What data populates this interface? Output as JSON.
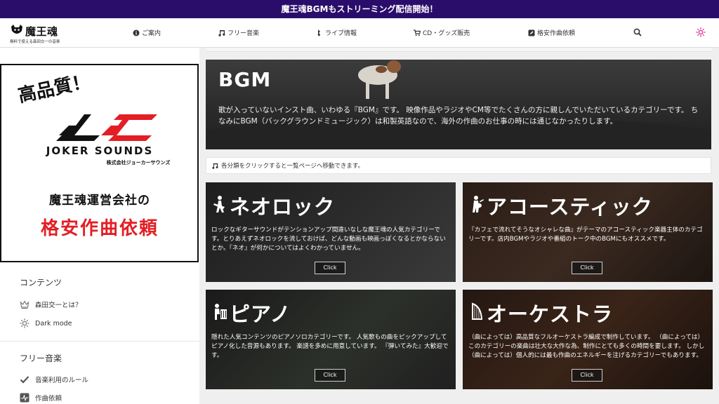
{
  "announcement": "魔王魂BGMもストリーミング配信開始！",
  "header": {
    "logo_title": "魔王魂",
    "logo_subtitle": "無料で使える森田交一の音楽",
    "nav": [
      {
        "label": "ご案内",
        "icon": "info-icon"
      },
      {
        "label": "フリー音楽",
        "icon": "music-note-icon"
      },
      {
        "label": "ライブ情報",
        "icon": "guitar-icon"
      },
      {
        "label": "CD・グッズ販売",
        "icon": "cart-icon"
      },
      {
        "label": "格安作曲依頼",
        "icon": "pen-square-icon"
      }
    ]
  },
  "banner": {
    "quality": "高品質！",
    "brand": "JOKER SOUNDS",
    "company": "株式会社ジョーカーサウンズ",
    "line1": "魔王魂運営会社の",
    "line2": "格安作曲依頼"
  },
  "sidebar": {
    "contents_heading": "コンテンツ",
    "contents_items": [
      {
        "label": "森田交一とは？",
        "icon": "crown-icon"
      },
      {
        "label": "Dark mode",
        "icon": "sun-icon"
      }
    ],
    "music_heading": "フリー音楽",
    "music_items": [
      {
        "label": "音楽利用のルール",
        "icon": "check-icon"
      },
      {
        "label": "作曲依頼",
        "icon": "pulse-icon"
      }
    ]
  },
  "hero": {
    "title": "BGM",
    "description": "歌が入っていないインスト曲、いわゆる『BGM』です。 映像作品やラジオやCM等でたくさんの方に親しんでいただいているカテゴリーです。 ちなみにBGM（バックグラウンドミュージック）は和製英語なので、海外の作曲のお仕事の時には通じなかったりします。"
  },
  "notice": "各分類をクリックすると一覧ページへ移動できます。",
  "cards": [
    {
      "title": "ネオロック",
      "icon": "rock-guitarist-icon",
      "description": "ロックなギターサウンドがテンションアップ間違いなしな魔王魂の人気カテゴリーです。とりあえずネオロックを流しておけば、どんな動画も映画っぽくなるとかならないとか。『ネオ』が何かについてはよくわかっていません。",
      "button": "Click"
    },
    {
      "title": "アコースティック",
      "icon": "acoustic-guitarist-icon",
      "description": "『カフェで流れてそうなオシャレな曲』がテーマのアコースティック楽器主体のカテゴリーです。店内BGMやラジオや番組のトーク中のBGMにもオススメです。",
      "button": "Click"
    },
    {
      "title": "ピアノ",
      "icon": "pianist-icon",
      "description": "隠れた人気コンテンツのピアノソロカテゴリーです。 人気歌もの曲をピックアップしてピアノ化した音源もあります。 楽譜を多めに用意しています。 『弾いてみた』大歓迎です。",
      "button": "Click"
    },
    {
      "title": "オーケストラ",
      "icon": "harp-icon",
      "description": "（曲によっては）高品質なフルオーケストラ編成で制作しています。 （曲によっては）このカテゴリーの楽曲は壮大な大作な為、制作にとても多くの時間を要します。 しかし（曲によっては）個人的には最も作曲のエネルギーを注げるカテゴリーでもあります。",
      "button": "Click"
    }
  ],
  "colors": {
    "announce_bg": "#2a0d6b",
    "banner_red": "#e31e24",
    "sun_pink": "#e0379a"
  }
}
